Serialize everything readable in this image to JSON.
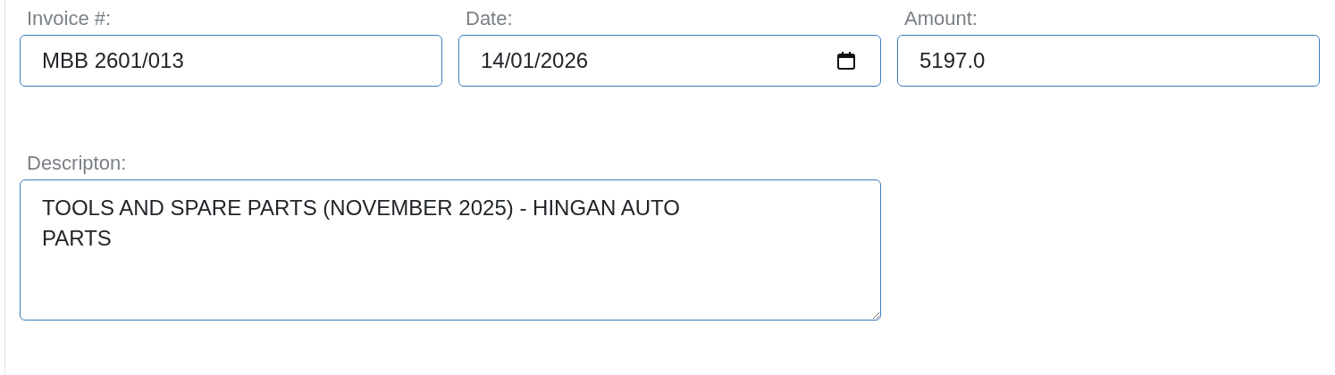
{
  "fields": [
    {
      "kind": "text",
      "label": "Invoice #:",
      "value": "MBB 2601/013"
    },
    {
      "kind": "date",
      "label": "Date:",
      "value": "14/01/2026"
    },
    {
      "kind": "text",
      "label": "Amount:",
      "value": "5197.0"
    },
    {
      "kind": "textarea",
      "label": "Descripton:",
      "value": "TOOLS AND SPARE PARTS (NOVEMBER 2025) - HINGAN AUTO PARTS"
    }
  ]
}
